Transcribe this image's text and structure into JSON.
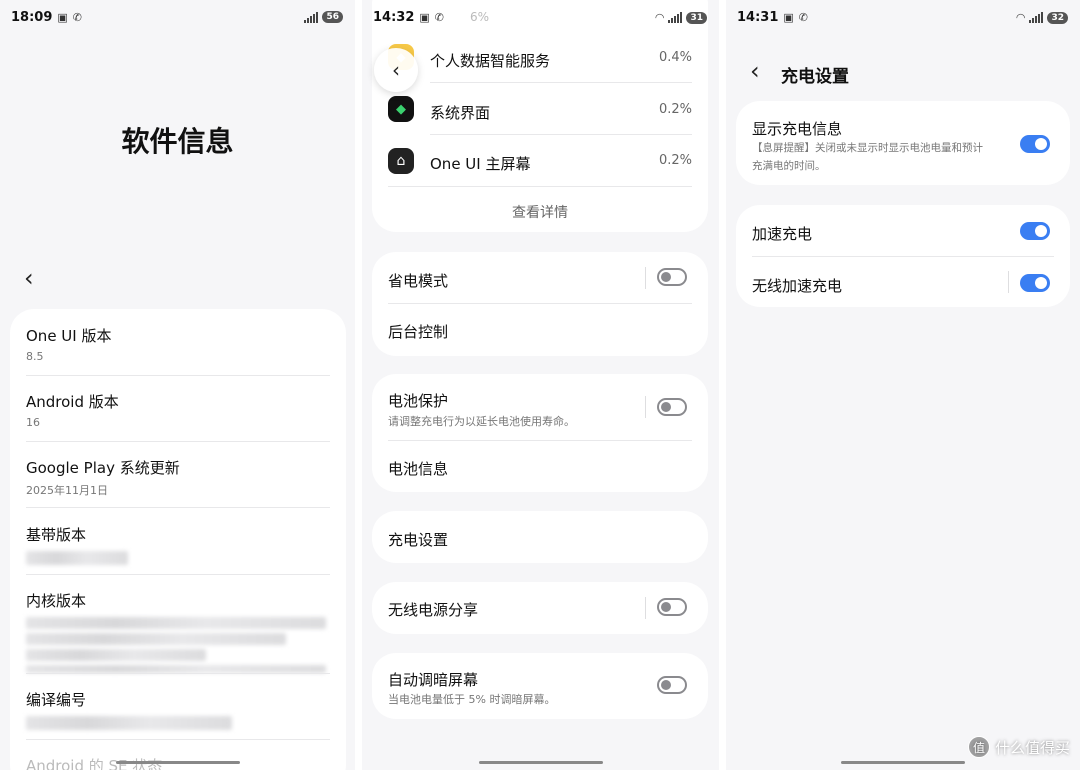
{
  "screens": [
    {
      "status": {
        "time": "18:09",
        "battery": "56"
      },
      "page_title": "软件信息",
      "items": [
        {
          "title": "One UI 版本",
          "value": "8.5"
        },
        {
          "title": "Android 版本",
          "value": "16"
        },
        {
          "title": "Google Play 系统更新",
          "value": "2025年11月1日"
        },
        {
          "title": "基带版本"
        },
        {
          "title": "内核版本"
        },
        {
          "title": "编译编号"
        },
        {
          "title": "Android 的 SE 状态"
        }
      ]
    },
    {
      "status": {
        "time": "14:32",
        "battery": "31"
      },
      "peek_text": "6%",
      "apps": [
        {
          "name": "个人数据智能服务",
          "percent": "0.4%"
        },
        {
          "name": "系统界面",
          "percent": "0.2%"
        },
        {
          "name": "One UI 主屏幕",
          "percent": "0.2%"
        }
      ],
      "view_details": "查看详情",
      "settings": {
        "power_saving": "省电模式",
        "background_control": "后台控制",
        "battery_protection": "电池保护",
        "battery_protection_desc": "请调整充电行为以延长电池使用寿命。",
        "battery_info": "电池信息",
        "charging_settings": "充电设置",
        "wireless_powershare": "无线电源分享",
        "auto_dim": "自动调暗屏幕",
        "auto_dim_desc": "当电池电量低于 5% 时调暗屏幕。"
      }
    },
    {
      "status": {
        "time": "14:31",
        "battery": "32"
      },
      "page_title": "充电设置",
      "show_charging_info": "显示充电信息",
      "show_charging_info_desc_line1": "【息屏提醒】关闭或未显示时显示电池电量和预计",
      "show_charging_info_desc_line2": "充满电的时间。",
      "fast_charging": "加速充电",
      "wireless_fast_charging": "无线加速充电"
    }
  ],
  "watermark": "什么值得买",
  "colors": {
    "accent": "#3a7ef2",
    "background": "#f6f6f8",
    "card": "#ffffff"
  }
}
